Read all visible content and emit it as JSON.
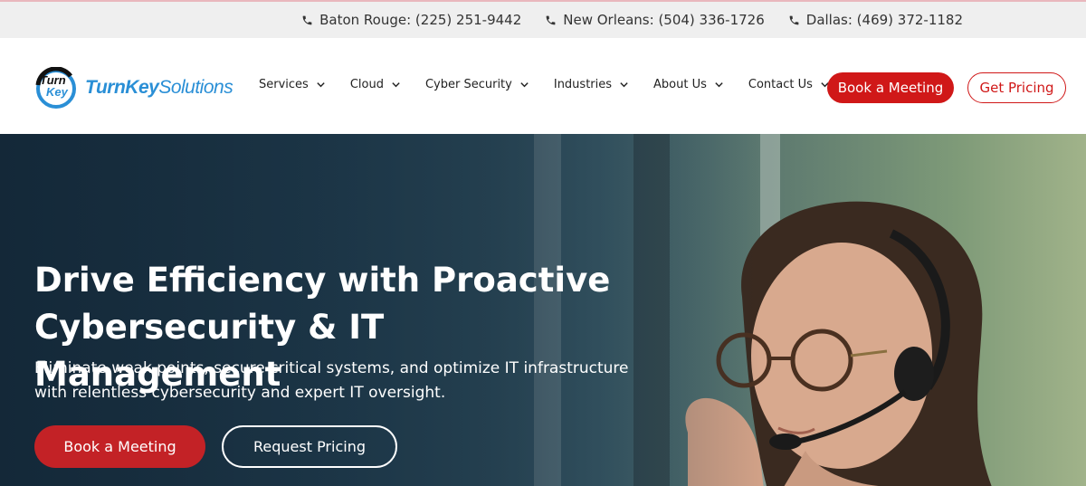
{
  "topbar": {
    "phones": [
      {
        "label": "Baton Rouge: (225) 251-9442",
        "icon": "phone-icon"
      },
      {
        "label": "New Orleans: (504) 336-1726",
        "icon": "phone-icon"
      },
      {
        "label": "Dallas: (469) 372-1182",
        "icon": "phone-icon"
      }
    ]
  },
  "header": {
    "logo": {
      "mark_top": "Turn",
      "mark_bottom": "Key",
      "text_bold": "TurnKey",
      "text_light": "Solutions"
    },
    "nav": [
      {
        "label": "Services"
      },
      {
        "label": "Cloud"
      },
      {
        "label": "Cyber Security"
      },
      {
        "label": "Industries"
      },
      {
        "label": "About Us"
      },
      {
        "label": "Contact Us"
      }
    ],
    "book_label": "Book a Meeting",
    "pricing_label": "Get Pricing"
  },
  "hero": {
    "title_line1": "Drive Efficiency with Proactive",
    "title_line2": "Cybersecurity & IT Management",
    "subtitle_line1": "Eliminate weak points, secure critical systems, and optimize IT infrastructure",
    "subtitle_line2": "with relentless cybersecurity and expert IT oversight.",
    "book_label": "Book a Meeting",
    "request_label": "Request Pricing"
  },
  "colors": {
    "accent_red": "#d01818",
    "logo_blue": "#2a8fd6",
    "hero_dark": "#1d3546"
  }
}
